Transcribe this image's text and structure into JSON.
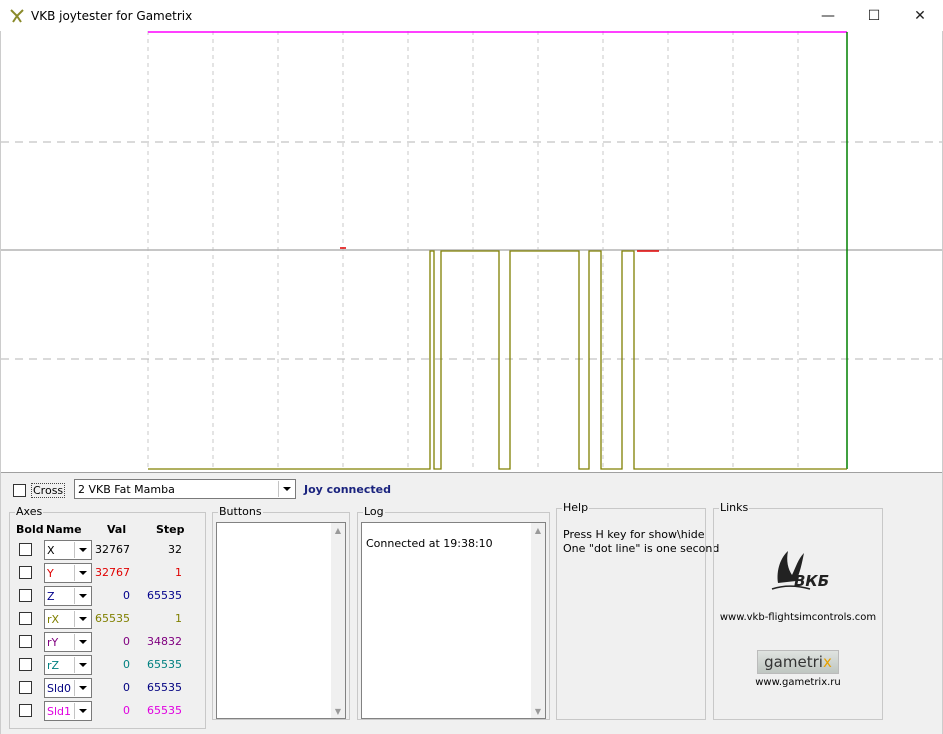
{
  "window": {
    "title": "VKB joytester for Gametrix",
    "min_glyph": "—",
    "max_glyph": "☐",
    "close_glyph": "✕",
    "icon": "vkb-app-icon"
  },
  "controls": {
    "cross_label": "Cross",
    "cross_checked": false,
    "device_selected": "2 VKB Fat Mamba",
    "status": "Joy connected"
  },
  "axes": {
    "group_title": "Axes",
    "headers": {
      "bold": "Bold",
      "name": "Name",
      "val": "Val",
      "step": "Step"
    },
    "rows": [
      {
        "name": "X",
        "val": "32767",
        "step": "32",
        "color": "#000000"
      },
      {
        "name": "Y",
        "val": "32767",
        "step": "1",
        "color": "#e00000"
      },
      {
        "name": "Z",
        "val": "0",
        "step": "65535",
        "color": "#00008b"
      },
      {
        "name": "rX",
        "val": "65535",
        "step": "1",
        "color": "#808000"
      },
      {
        "name": "rY",
        "val": "0",
        "step": "34832",
        "color": "#800080"
      },
      {
        "name": "rZ",
        "val": "0",
        "step": "65535",
        "color": "#008080"
      },
      {
        "name": "Sld0",
        "val": "0",
        "step": "65535",
        "color": "#000080"
      },
      {
        "name": "Sld1",
        "val": "0",
        "step": "65535",
        "color": "#e000e0"
      }
    ]
  },
  "buttons_group": {
    "title": "Buttons"
  },
  "log": {
    "title": "Log",
    "lines": [
      "Connected at 19:38:10"
    ]
  },
  "help": {
    "title": "Help",
    "lines": [
      "Press H key for show\\hide",
      "One \"dot line\" is one second"
    ]
  },
  "links": {
    "title": "Links",
    "vkb_logo_text": "ВКБ",
    "vkb_url": "www.vkb-flightsimcontrols.com",
    "gametrix_logo": {
      "pre": "gametri",
      "x": "x"
    },
    "gametrix_url": "www.gametrix.ru"
  },
  "plot_colors": {
    "top_line": "#ff00ff",
    "right_line": "#008000",
    "rx_trace": "#808000",
    "y_trace": "#e00000",
    "center_line": "#b4b4b4",
    "grid": "#c8c8c8"
  }
}
